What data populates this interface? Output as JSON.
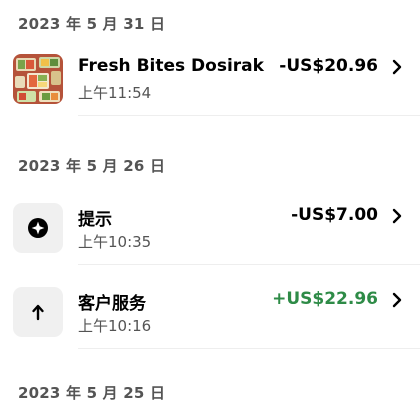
{
  "sections": [
    {
      "date": "2023 年 5 月 31 日",
      "items": [
        {
          "title": "Fresh Bites Dosirak",
          "time": "上午11:54",
          "amount": "-US$20.96",
          "icon": "food-thumbnail"
        }
      ]
    },
    {
      "date": "2023 年 5 月 26 日",
      "items": [
        {
          "title": "提示",
          "time": "上午10:35",
          "amount": "-US$7.00",
          "icon": "sparkle-icon"
        },
        {
          "title": "客户服务",
          "time": "上午10:16",
          "amount": "+US$22.96",
          "icon": "arrow-up-icon"
        }
      ]
    },
    {
      "date": "2023 年 5 月 25 日",
      "items": []
    }
  ],
  "colors": {
    "positive_amount": "#2e8b47",
    "secondary_text": "#545454",
    "icon_background": "#f0f0f0"
  }
}
